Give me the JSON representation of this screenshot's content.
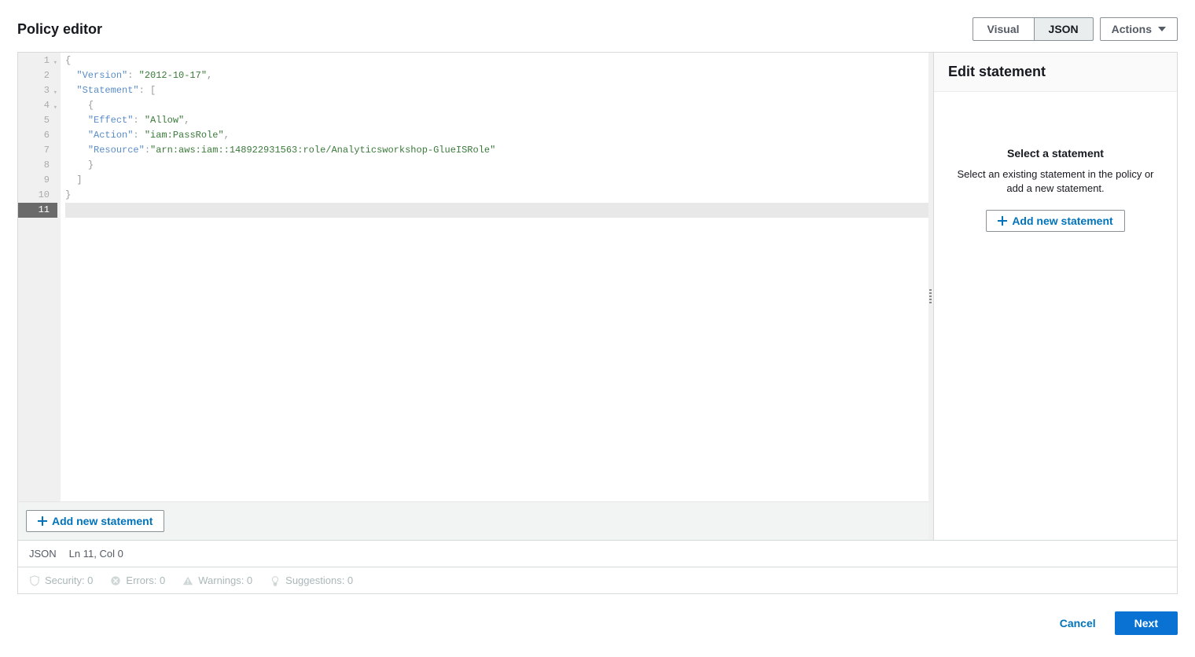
{
  "header": {
    "title": "Policy editor",
    "tabs": {
      "visual": "Visual",
      "json": "JSON"
    },
    "actions_label": "Actions"
  },
  "code": {
    "lines": [
      {
        "n": 1,
        "fold": true,
        "tokens": [
          [
            "punct",
            "{"
          ]
        ]
      },
      {
        "n": 2,
        "fold": false,
        "tokens": [
          [
            "plain",
            "  "
          ],
          [
            "key",
            "\"Version\""
          ],
          [
            "punct",
            ": "
          ],
          [
            "str",
            "\"2012-10-17\""
          ],
          [
            "punct",
            ","
          ]
        ]
      },
      {
        "n": 3,
        "fold": true,
        "tokens": [
          [
            "plain",
            "  "
          ],
          [
            "key",
            "\"Statement\""
          ],
          [
            "punct",
            ": ["
          ]
        ]
      },
      {
        "n": 4,
        "fold": true,
        "tokens": [
          [
            "plain",
            "    "
          ],
          [
            "punct",
            "{"
          ]
        ]
      },
      {
        "n": 5,
        "fold": false,
        "tokens": [
          [
            "plain",
            "    "
          ],
          [
            "key",
            "\"Effect\""
          ],
          [
            "punct",
            ": "
          ],
          [
            "str",
            "\"Allow\""
          ],
          [
            "punct",
            ","
          ]
        ]
      },
      {
        "n": 6,
        "fold": false,
        "tokens": [
          [
            "plain",
            "    "
          ],
          [
            "key",
            "\"Action\""
          ],
          [
            "punct",
            ": "
          ],
          [
            "str",
            "\"iam:PassRole\""
          ],
          [
            "punct",
            ","
          ]
        ]
      },
      {
        "n": 7,
        "fold": false,
        "tokens": [
          [
            "plain",
            "    "
          ],
          [
            "key",
            "\"Resource\""
          ],
          [
            "punct",
            ":"
          ],
          [
            "str",
            "\"arn:aws:iam::148922931563:role/Analyticsworkshop-GlueISRole\""
          ]
        ]
      },
      {
        "n": 8,
        "fold": false,
        "tokens": [
          [
            "plain",
            "    "
          ],
          [
            "punct",
            "}"
          ]
        ]
      },
      {
        "n": 9,
        "fold": false,
        "tokens": [
          [
            "plain",
            "  "
          ],
          [
            "punct",
            "]"
          ]
        ]
      },
      {
        "n": 10,
        "fold": false,
        "tokens": [
          [
            "punct",
            "}"
          ]
        ]
      },
      {
        "n": 11,
        "fold": false,
        "tokens": []
      }
    ],
    "active_line": 11,
    "add_statement_label": "Add new statement"
  },
  "right_panel": {
    "header": "Edit statement",
    "subtitle": "Select a statement",
    "description": "Select an existing statement in the policy or add a new statement.",
    "add_button": "Add new statement"
  },
  "status_bar": {
    "lang": "JSON",
    "position": "Ln 11, Col 0"
  },
  "diagnostics": {
    "security": "Security: 0",
    "errors": "Errors: 0",
    "warnings": "Warnings: 0",
    "suggestions": "Suggestions: 0"
  },
  "footer": {
    "cancel": "Cancel",
    "next": "Next"
  }
}
